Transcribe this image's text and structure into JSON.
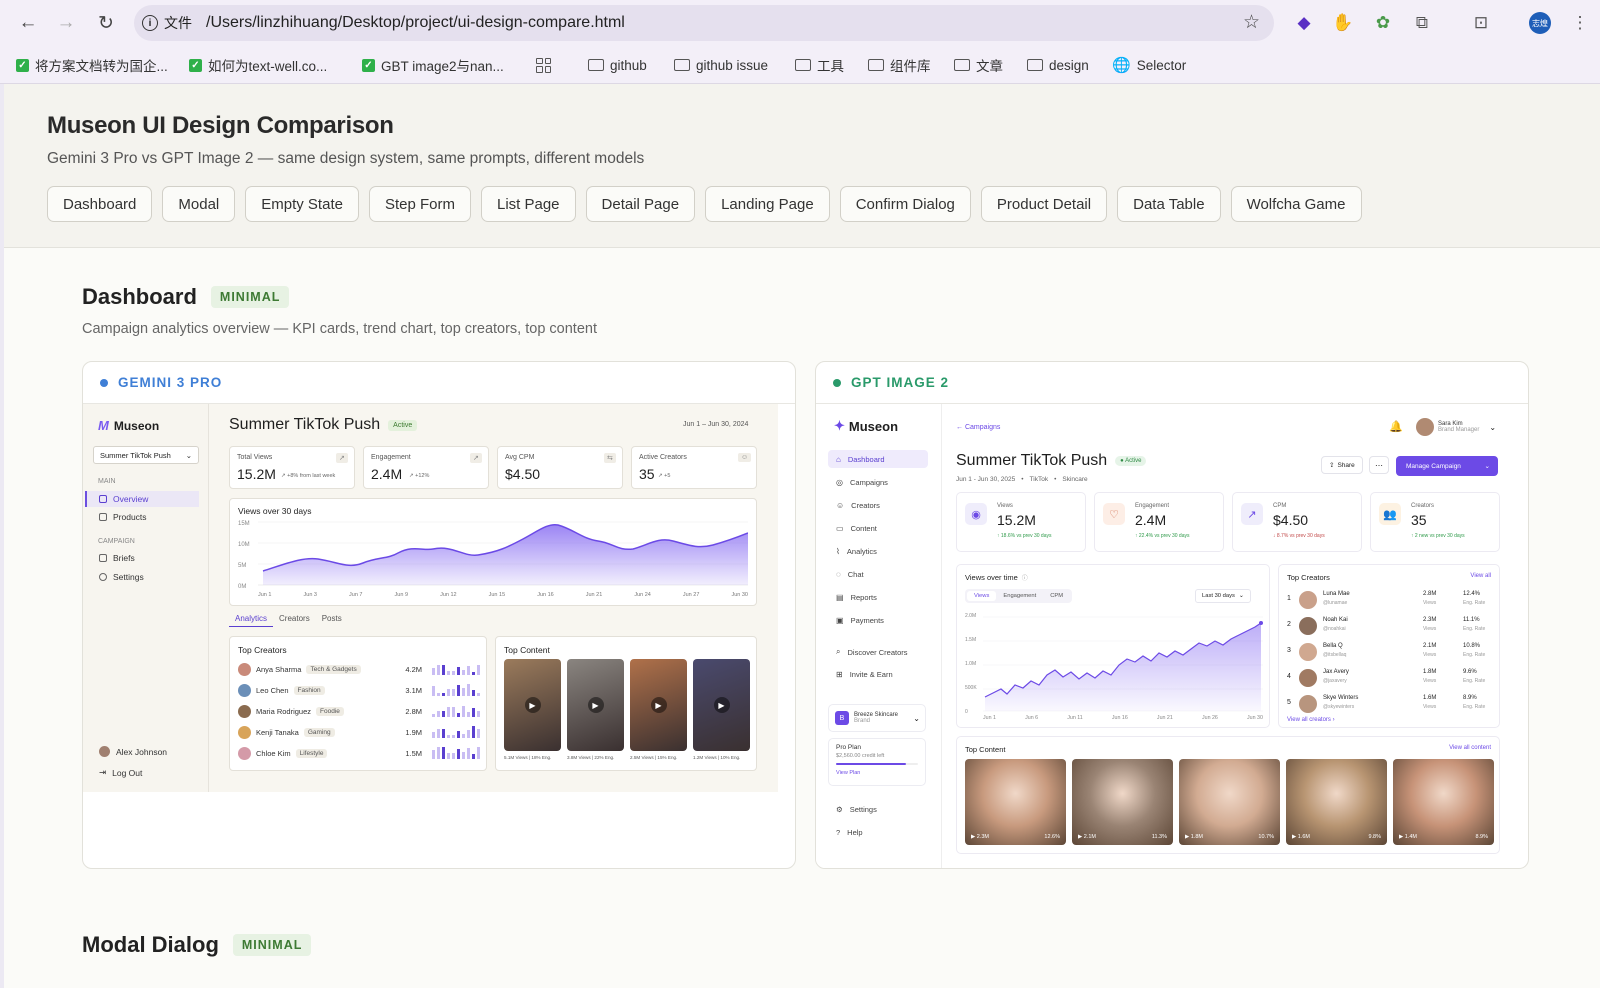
{
  "browser": {
    "tab_info_label": "文件",
    "url": "/Users/linzhihuang/Desktop/project/ui-design-compare.html",
    "avatar_label": "志煌",
    "bookmarks": [
      {
        "label": "将方案文档转为国企..."
      },
      {
        "label": "如何为text-well.co..."
      },
      {
        "label": "GBT image2与nan..."
      },
      {
        "label": "github"
      },
      {
        "label": "github issue"
      },
      {
        "label": "工具"
      },
      {
        "label": "组件库"
      },
      {
        "label": "文章"
      },
      {
        "label": "design"
      },
      {
        "label": "Selector"
      }
    ]
  },
  "page": {
    "title": "Museon UI Design Comparison",
    "subtitle": "Gemini 3 Pro vs GPT Image 2 — same design system, same prompts, different models",
    "tabs": [
      "Dashboard",
      "Modal",
      "Empty State",
      "Step Form",
      "List Page",
      "Detail Page",
      "Landing Page",
      "Confirm Dialog",
      "Product Detail",
      "Data Table",
      "Wolfcha Game"
    ],
    "section": {
      "title": "Dashboard",
      "badge": "MINIMAL",
      "description": "Campaign analytics overview — KPI cards, trend chart, top creators, top content"
    },
    "next_section": {
      "title": "Modal Dialog",
      "badge": "MINIMAL"
    }
  },
  "gemini": {
    "label": "GEMINI 3 PRO",
    "accent": "#3f7fd6",
    "brand": "Museon",
    "campaign_select": "Summer TikTok Push",
    "nav_main": "MAIN",
    "nav_items_main": [
      "Overview",
      "Products"
    ],
    "nav_campaign": "CAMPAIGN",
    "nav_items_campaign": [
      "Briefs",
      "Settings"
    ],
    "user": "Alex Johnson",
    "logout": "Log Out",
    "title": "Summer TikTok Push",
    "status": "Active",
    "date_range": "Jun 1 – Jun 30, 2024",
    "kpis": [
      {
        "label": "Total Views",
        "value": "15.2M",
        "delta": "↗ +8% from last week"
      },
      {
        "label": "Engagement",
        "value": "2.4M",
        "delta": "↗ +12%"
      },
      {
        "label": "Avg CPM",
        "value": "$4.50",
        "delta": ""
      },
      {
        "label": "Active Creators",
        "value": "35",
        "delta": "↗ +5"
      }
    ],
    "chart": {
      "title": "Views over 30 days",
      "y_ticks": [
        "15M",
        "10M",
        "5M",
        "0M"
      ],
      "x_ticks": [
        "Jun 1",
        "Jun 3",
        "Jun 7",
        "Jun 9",
        "Jun 12",
        "Jun 15",
        "Jun 16",
        "Jun 21",
        "Jun 24",
        "Jun 27",
        "Jun 30"
      ]
    },
    "subtabs": [
      "Analytics",
      "Creators",
      "Posts"
    ],
    "top_creators_title": "Top Creators",
    "creators": [
      {
        "name": "Anya Sharma",
        "tag": "Tech & Gadgets",
        "value": "4.2M",
        "color": "#c98a7a"
      },
      {
        "name": "Leo Chen",
        "tag": "Fashion",
        "value": "3.1M",
        "color": "#6b8fb8"
      },
      {
        "name": "Maria Rodriguez",
        "tag": "Foodie",
        "value": "2.8M",
        "color": "#8a6b4f"
      },
      {
        "name": "Kenji Tanaka",
        "tag": "Gaming",
        "value": "1.9M",
        "color": "#d8a45a"
      },
      {
        "name": "Chloe Kim",
        "tag": "Lifestyle",
        "value": "1.5M",
        "color": "#d49aa8"
      }
    ],
    "top_content_title": "Top Content",
    "content": [
      {
        "caption": "5.1M Views | 18% Eng.",
        "color": "#9b7b5c"
      },
      {
        "caption": "3.8M Views | 22% Eng.",
        "color": "#8a8580"
      },
      {
        "caption": "2.5M Views | 15% Eng.",
        "color": "#b0714a"
      },
      {
        "caption": "1.2M Views | 10% Eng.",
        "color": "#4a4a6e"
      }
    ]
  },
  "gpt": {
    "label": "GPT IMAGE 2",
    "accent": "#2a9a6a",
    "brand": "Museon",
    "nav": [
      "Dashboard",
      "Campaigns",
      "Creators",
      "Content",
      "Analytics",
      "Chat",
      "Reports",
      "Payments"
    ],
    "nav2": [
      "Discover Creators",
      "Invite & Earn"
    ],
    "brand_card": {
      "name": "Breeze Skincare",
      "role": "Brand"
    },
    "plan": {
      "name": "Pro Plan",
      "credit": "$2,560.00 credit left",
      "link": "View Plan"
    },
    "nav_bottom": [
      "Settings",
      "Help"
    ],
    "breadcrumb": "Campaigns",
    "user": {
      "name": "Sara Kim",
      "role": "Brand Manager"
    },
    "title": "Summer TikTok Push",
    "status": "Active",
    "meta": [
      "Jun 1 - Jun 30, 2025",
      "TikTok",
      "Skincare"
    ],
    "share": "Share",
    "manage": "Manage Campaign",
    "kpis": [
      {
        "label": "Views",
        "value": "15.2M",
        "delta": "↑ 18.6% vs prev 30 days",
        "icon": "◉"
      },
      {
        "label": "Engagement",
        "value": "2.4M",
        "delta": "↑ 22.4% vs prev 30 days",
        "icon": "♡"
      },
      {
        "label": "CPM",
        "value": "$4.50",
        "delta": "↓ 8.7% vs prev 30 days",
        "icon": "↗"
      },
      {
        "label": "Creators",
        "value": "35",
        "delta": "↑ 2 new vs prev 30 days",
        "icon": "👥"
      }
    ],
    "chart": {
      "title": "Views over time",
      "tabs": [
        "Views",
        "Engagement",
        "CPM"
      ],
      "range": "Last 30 days",
      "y_ticks": [
        "2.0M",
        "1.5M",
        "1.0M",
        "500K",
        "0"
      ],
      "x_ticks": [
        "Jun 1",
        "Jun 6",
        "Jun 11",
        "Jun 16",
        "Jun 21",
        "Jun 26",
        "Jun 30"
      ]
    },
    "top_creators": {
      "title": "Top Creators",
      "view_all": "View all",
      "footer": "View all creators",
      "rows": [
        {
          "rank": "1",
          "name": "Luna Mae",
          "handle": "@lunamae",
          "views": "2.8M",
          "rate": "12.4%"
        },
        {
          "rank": "2",
          "name": "Noah Kai",
          "handle": "@noahkai",
          "views": "2.3M",
          "rate": "11.1%"
        },
        {
          "rank": "3",
          "name": "Bella Q",
          "handle": "@itsbellaq",
          "views": "2.1M",
          "rate": "10.8%"
        },
        {
          "rank": "4",
          "name": "Jax Avery",
          "handle": "@jaxavery",
          "views": "1.8M",
          "rate": "9.6%"
        },
        {
          "rank": "5",
          "name": "Skye Winters",
          "handle": "@skyewinters",
          "views": "1.6M",
          "rate": "8.9%"
        }
      ],
      "col_views": "Views",
      "col_rate": "Eng. Rate"
    },
    "top_content": {
      "title": "Top Content",
      "view_all": "View all content",
      "items": [
        {
          "views": "▶ 2.3M",
          "rate": "12.6%",
          "color": "#c89a7e"
        },
        {
          "views": "▶ 2.1M",
          "rate": "11.3%",
          "color": "#9a8474"
        },
        {
          "views": "▶ 1.8M",
          "rate": "10.7%",
          "color": "#d2ab92"
        },
        {
          "views": "▶ 1.6M",
          "rate": "9.8%",
          "color": "#b89572"
        },
        {
          "views": "▶ 1.4M",
          "rate": "8.9%",
          "color": "#c79378"
        }
      ]
    }
  }
}
